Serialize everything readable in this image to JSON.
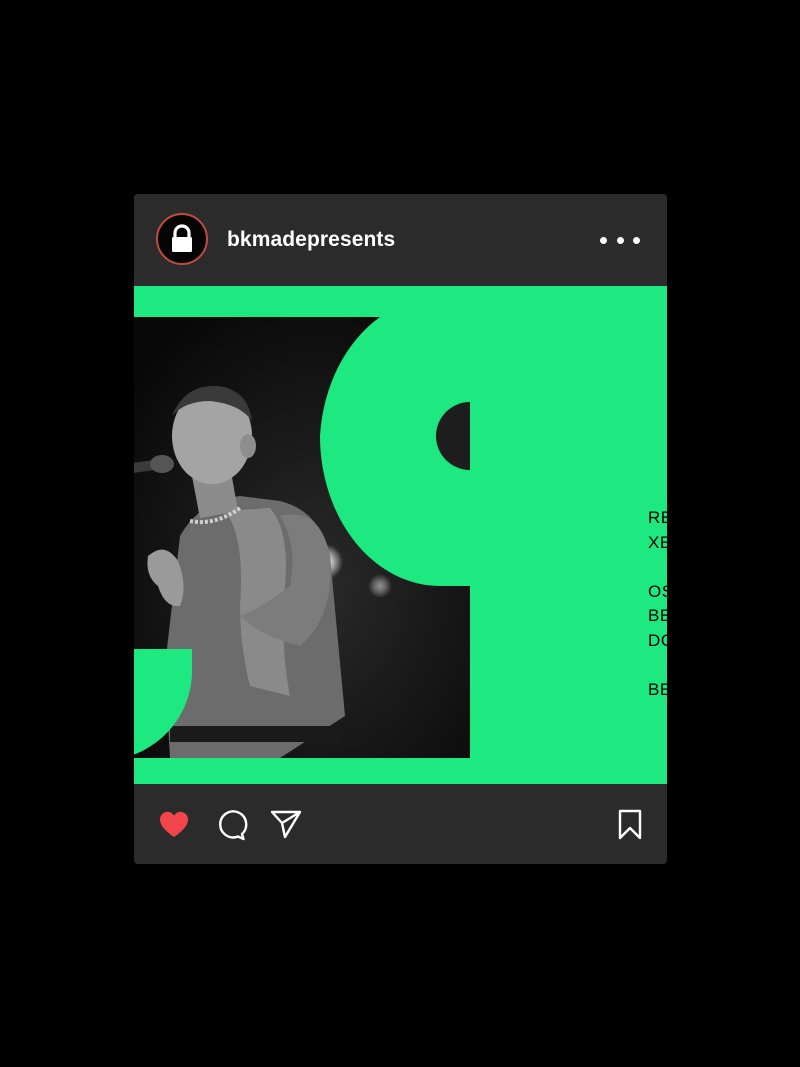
{
  "post": {
    "username": "bkmadepresents",
    "avatar_icon": "lock-icon",
    "more_icon": "more-horizontal-icon",
    "media": {
      "side_text_lines": [
        "RE",
        "XE",
        "",
        "OS",
        "BE",
        "DC",
        "",
        "BE"
      ],
      "accent_color": "#1ee981",
      "photo_description_icon": "performer-photo"
    },
    "actions": {
      "like_icon": "heart-icon",
      "comment_icon": "comment-icon",
      "share_icon": "send-icon",
      "save_icon": "bookmark-icon",
      "liked": true,
      "like_color": "#f2444b"
    }
  }
}
